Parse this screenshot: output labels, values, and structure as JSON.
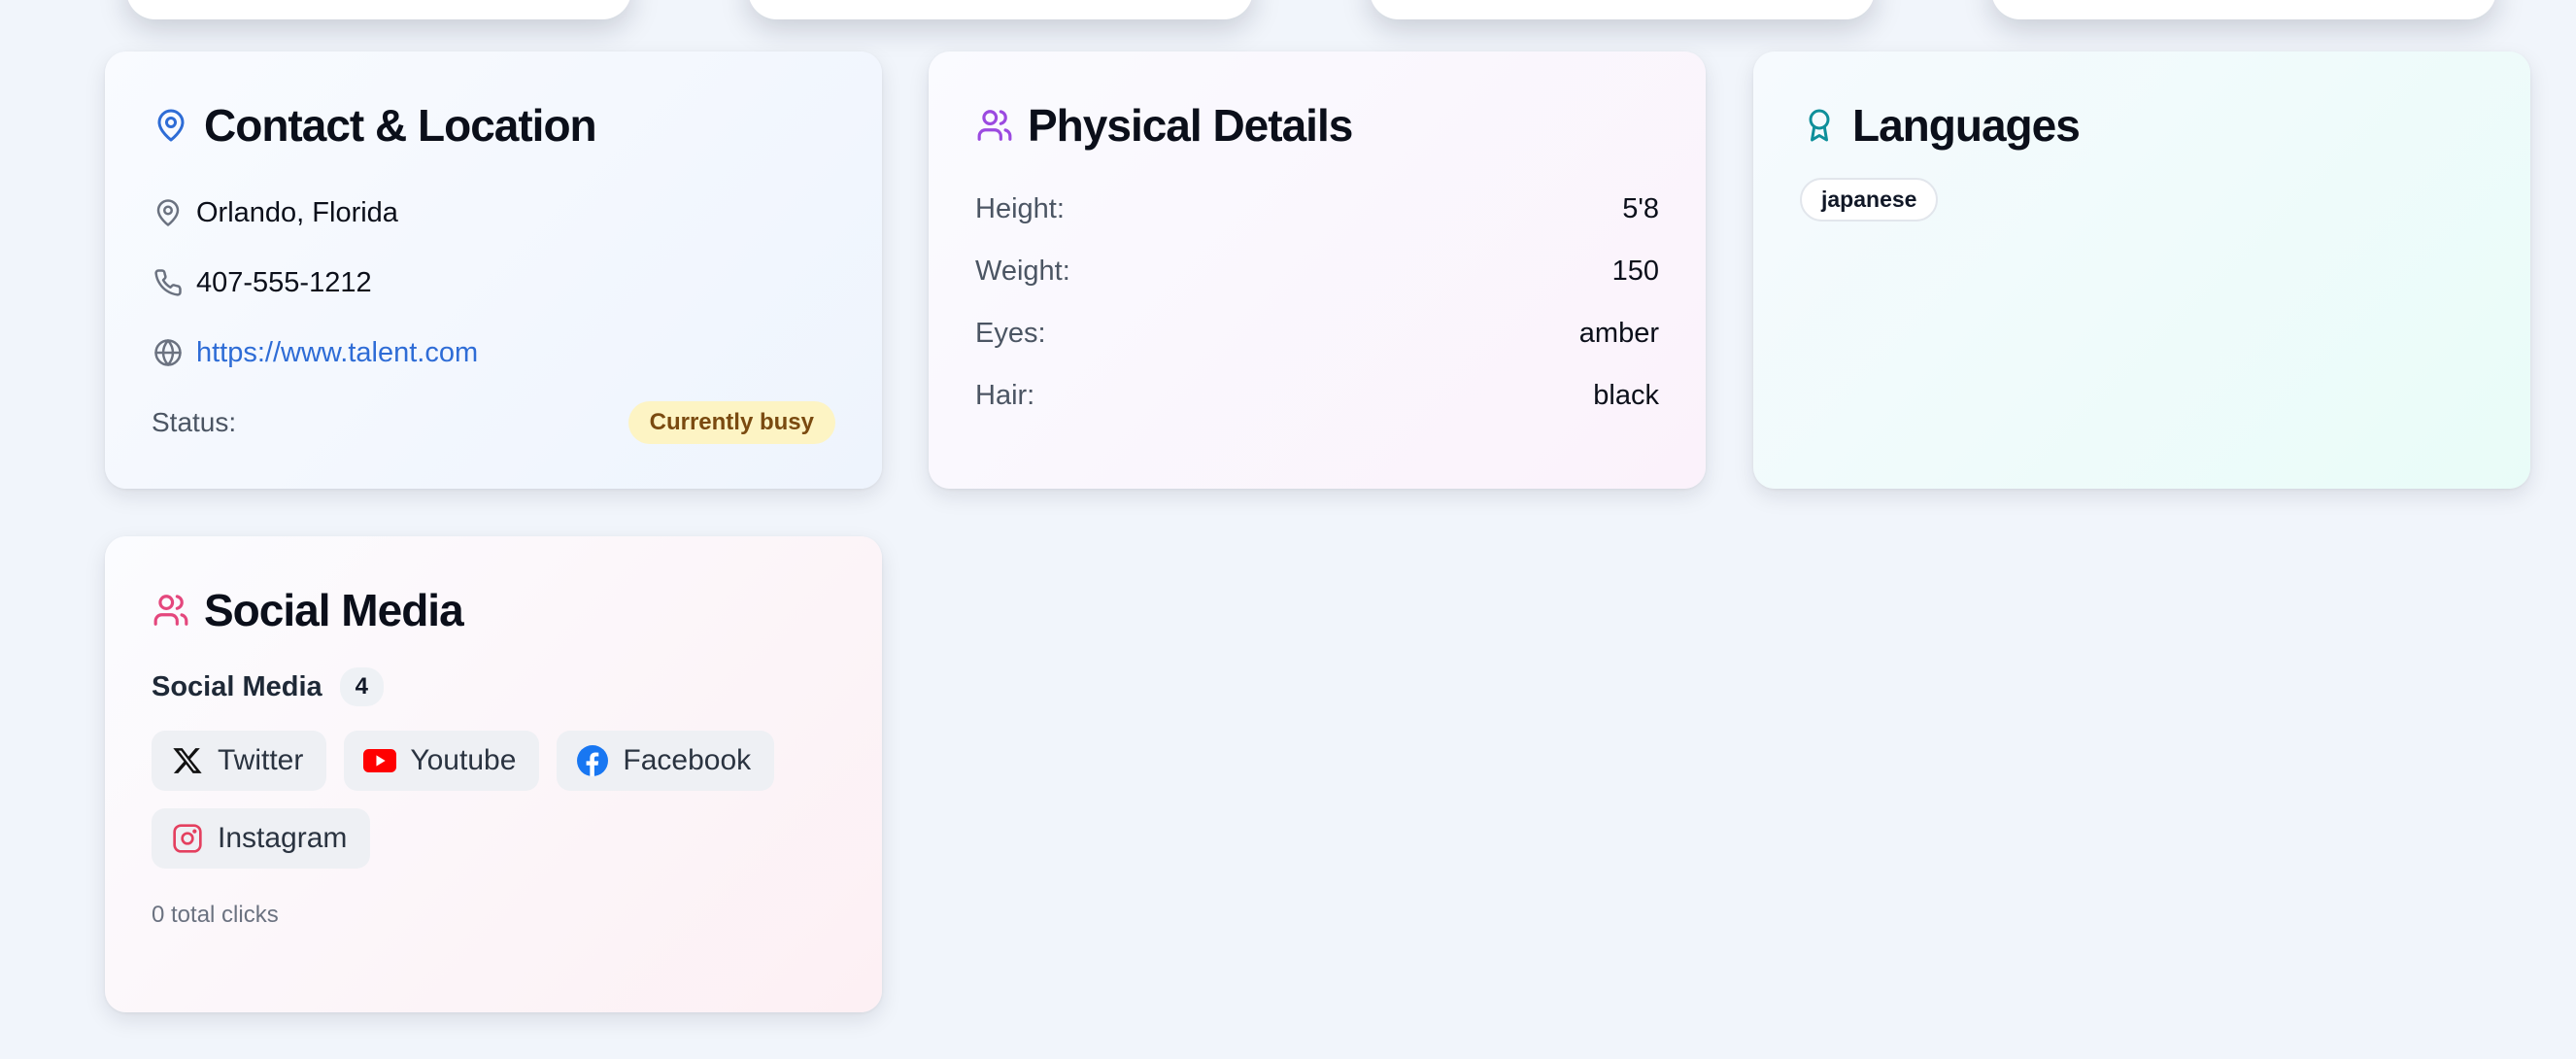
{
  "colors": {
    "contact_icon": "#2e6cd6",
    "physical_icon": "#9b4ae0",
    "languages_icon": "#0e8f9a",
    "social_icon": "#e4477d",
    "status_badge_bg": "#fdf4c4",
    "status_badge_text": "#7a4a10",
    "link": "#2e6cd6"
  },
  "contact": {
    "title": "Contact & Location",
    "title_icon": "map-pin-icon",
    "location": "Orlando, Florida",
    "location_icon": "map-pin-icon",
    "phone": "407-555-1212",
    "phone_icon": "phone-icon",
    "website": "https://www.talent.com",
    "website_icon": "globe-icon",
    "status_label": "Status:",
    "status_value": "Currently busy"
  },
  "physical": {
    "title": "Physical Details",
    "title_icon": "users-icon",
    "rows": [
      {
        "label": "Height:",
        "value": "5'8"
      },
      {
        "label": "Weight:",
        "value": "150"
      },
      {
        "label": "Eyes:",
        "value": "amber"
      },
      {
        "label": "Hair:",
        "value": "black"
      }
    ]
  },
  "languages": {
    "title": "Languages",
    "title_icon": "award-icon",
    "items": [
      "japanese"
    ]
  },
  "social": {
    "title": "Social Media",
    "title_icon": "users-icon",
    "subtitle": "Social Media",
    "count": "4",
    "platforms": [
      {
        "label": "Twitter",
        "icon": "x-twitter-icon"
      },
      {
        "label": "Youtube",
        "icon": "youtube-icon"
      },
      {
        "label": "Facebook",
        "icon": "facebook-icon"
      },
      {
        "label": "Instagram",
        "icon": "instagram-icon"
      }
    ],
    "clicks_text": "0 total clicks"
  }
}
